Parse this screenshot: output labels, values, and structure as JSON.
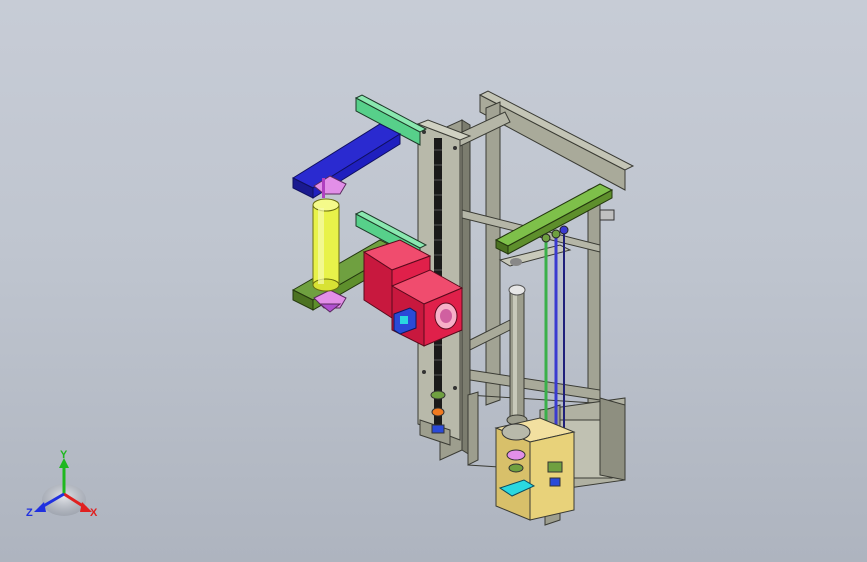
{
  "viewport": {
    "background_top": "#c7ccd6",
    "background_bottom": "#aeb4bf"
  },
  "triad": {
    "x_label": "X",
    "y_label": "Y",
    "z_label": "Z",
    "x_color": "#e02020",
    "y_color": "#1fb81f",
    "z_color": "#2030e0"
  },
  "colors": {
    "frame": "#a9aa9a",
    "frame_dark": "#6e6f63",
    "arm_blue": "#1f1fbf",
    "arm_green_light": "#57d08a",
    "arm_olive": "#5e8f2c",
    "cylinder_yellow": "#e8f24a",
    "gearbox_red": "#e0204a",
    "gripper_pink": "#e28fe8",
    "base_yellow": "#e8d27a",
    "rod_blue": "#3a3ad0",
    "rod_green": "#3ab04a",
    "motor_blue": "#2a4ad8",
    "small_cyan": "#2ad8e0",
    "small_orange": "#f07a20"
  }
}
